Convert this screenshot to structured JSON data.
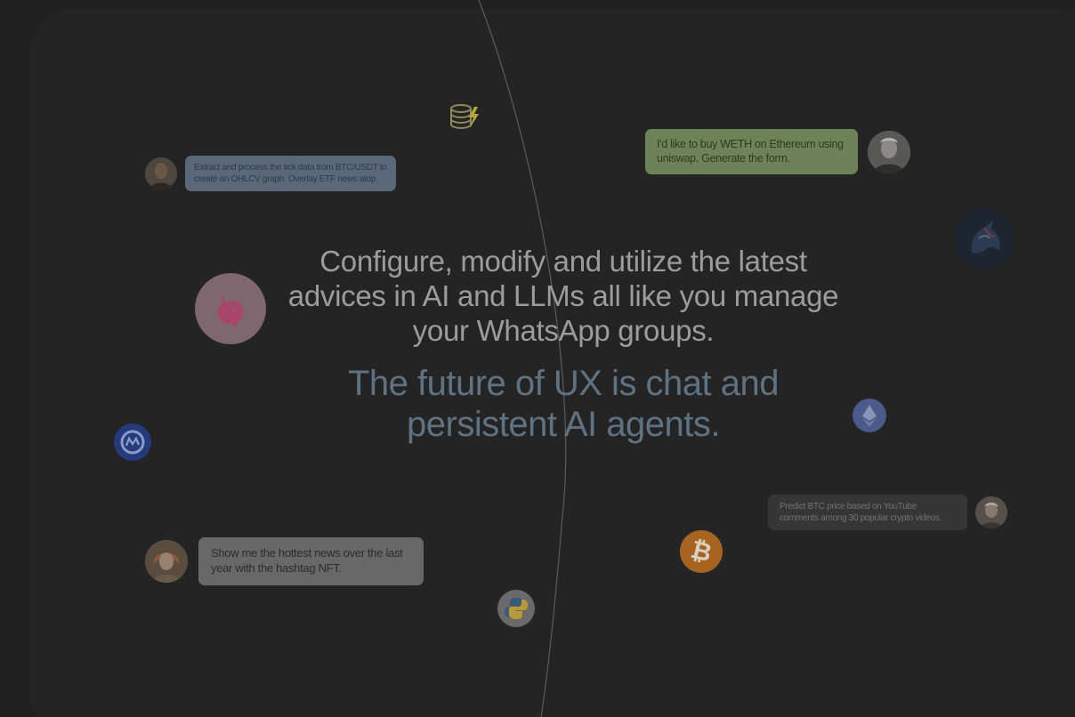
{
  "hero": {
    "headline": "Configure, modify and utilize the latest advices in AI and LLMs all like you manage your WhatsApp groups.",
    "tagline": "The future of UX is chat and persistent AI agents."
  },
  "chat_examples": [
    {
      "text": "Extract and process the tick data from BTC/USDT to create an OHLCV graph. Overlay ETF news atop."
    },
    {
      "text": "I'd like to buy WETH on Ethereum using uniswap. Generate the form."
    },
    {
      "text": "Show me the hottest news over the last year with the hashtag NFT."
    },
    {
      "text": "Predict BTC price based on YouTube comments among 30 popular crypto videos."
    }
  ],
  "icons": {
    "uniswap": "uniswap-unicorn-icon",
    "oneinch": "1inch-unicorn-icon",
    "coinmarketcap": "coinmarketcap-icon",
    "ethereum": "ethereum-icon",
    "bitcoin": "bitcoin-icon",
    "python": "python-icon",
    "database": "database-lightning-icon"
  },
  "colors": {
    "background": "#202020",
    "panel": "#242424",
    "headline": "#9c9c9c",
    "tagline": "#5f7281",
    "bubble_blue": "#5b6877",
    "bubble_green": "#6d8257",
    "bubble_grey": "#686868",
    "bubble_dark": "#363636",
    "bitcoin": "#a6641e",
    "uniswap": "#7e676f"
  }
}
